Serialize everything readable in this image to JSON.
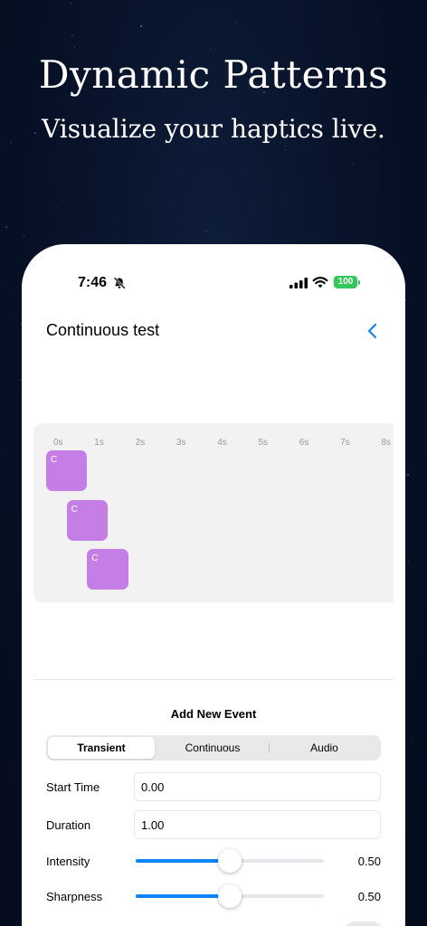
{
  "hero": {
    "title": "Dynamic Patterns",
    "subtitle": "Visualize your haptics live."
  },
  "status_bar": {
    "time": "7:46",
    "battery": "100",
    "icons": [
      "bell-slash-icon",
      "cellular-signal-icon",
      "wifi-icon",
      "battery-icon"
    ]
  },
  "nav": {
    "title": "Continuous test",
    "back_icon": "chevron-left-icon"
  },
  "timeline": {
    "ticks": [
      "0s",
      "1s",
      "2s",
      "3s",
      "4s",
      "5s",
      "6s",
      "7s",
      "8s"
    ],
    "events": [
      {
        "label": "C",
        "start": 0.0,
        "duration": 1.0
      },
      {
        "label": "C",
        "start": 0.5,
        "duration": 1.0
      },
      {
        "label": "C",
        "start": 1.0,
        "duration": 1.0
      }
    ],
    "event_color": "#c57ee6"
  },
  "form": {
    "section_title": "Add New Event",
    "segments": [
      {
        "label": "Transient",
        "selected": true
      },
      {
        "label": "Continuous",
        "selected": false
      },
      {
        "label": "Audio",
        "selected": false
      }
    ],
    "start_time": {
      "label": "Start Time",
      "value": "0.00"
    },
    "duration": {
      "label": "Duration",
      "value": "1.00"
    },
    "intensity": {
      "label": "Intensity",
      "value": 0.5,
      "display": "0.50"
    },
    "sharpness": {
      "label": "Sharpness",
      "value": 0.5,
      "display": "0.50"
    }
  },
  "colors": {
    "accent": "#0a84ff",
    "battery": "#34c759",
    "background": "#071127"
  }
}
